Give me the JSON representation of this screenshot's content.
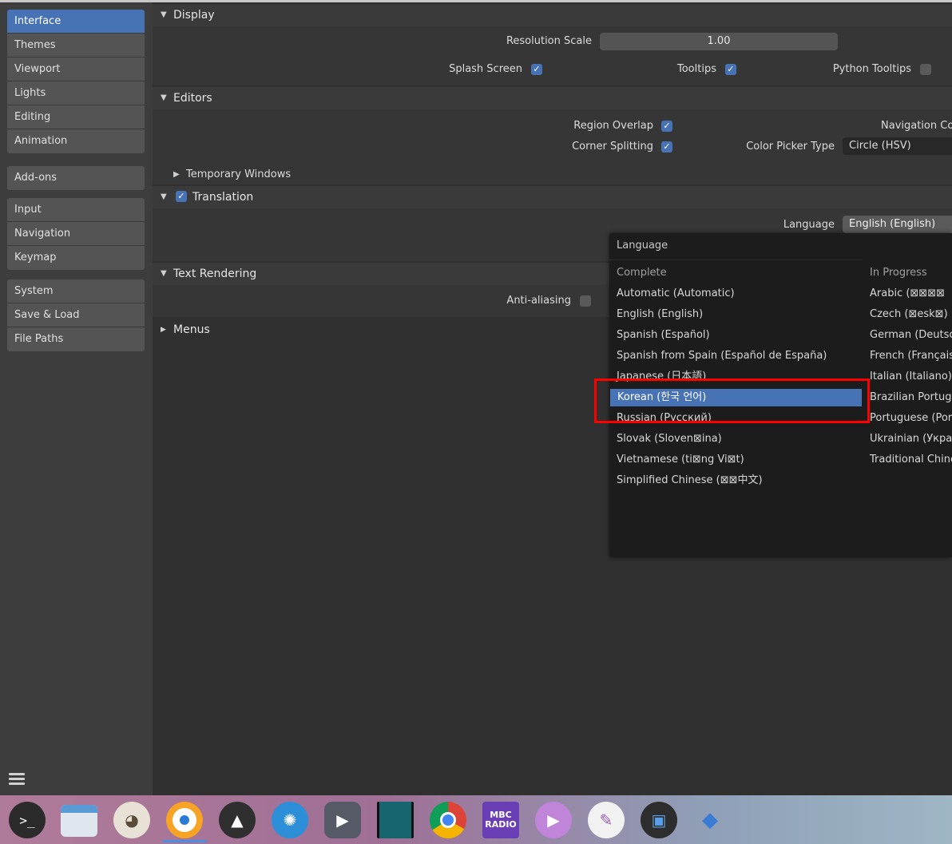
{
  "sidebar": {
    "groups": [
      [
        "Interface",
        "Themes",
        "Viewport",
        "Lights",
        "Editing",
        "Animation"
      ],
      [
        "Add-ons"
      ],
      [
        "Input",
        "Navigation",
        "Keymap"
      ],
      [
        "System",
        "Save & Load",
        "File Paths"
      ]
    ],
    "active": "Interface"
  },
  "display": {
    "header": "Display",
    "resolution_label": "Resolution Scale",
    "resolution_value": "1.00",
    "splash_label": "Splash Screen",
    "tooltips_label": "Tooltips",
    "python_tooltips_label": "Python Tooltips"
  },
  "editors": {
    "header": "Editors",
    "region_overlap_label": "Region Overlap",
    "navigation_controls_label": "Navigation Cor",
    "corner_splitting_label": "Corner Splitting",
    "color_picker_label": "Color Picker Type",
    "color_picker_value": "Circle (HSV)",
    "temp_windows_label": "Temporary Windows"
  },
  "translation": {
    "header": "Translation",
    "language_label": "Language",
    "language_value": "English (English)"
  },
  "text_rendering": {
    "header": "Text Rendering",
    "antialiasing_label": "Anti-aliasing"
  },
  "menus": {
    "header": "Menus"
  },
  "popup": {
    "title": "Language",
    "complete_header": "Complete",
    "in_progress_header": "In Progress",
    "complete": [
      "Automatic (Automatic)",
      "English (English)",
      "Spanish (Español)",
      "Spanish from Spain (Español de España)",
      "Japanese (日本語)",
      "Korean (한국 언어)",
      "Russian (Русский)",
      "Slovak (Sloven⊠ina)",
      "Vietnamese (ti⊠ng Vi⊠t)",
      "Simplified Chinese (⊠⊠中文)"
    ],
    "in_progress": [
      "Arabic (⊠⊠⊠⊠",
      "Czech (⊠esk⊠)",
      "German (Deutsch",
      "French (Français)",
      "Italian (Italiano)",
      "Brazilian Portugu",
      "Portuguese (Port",
      "Ukrainian (Украï",
      "Traditional Chine"
    ],
    "highlighted": "Korean (한국 언어)"
  },
  "taskbar": {
    "icons": [
      "terminal-icon",
      "files-icon",
      "gimp-icon",
      "orange-app-icon",
      "inkscape-icon",
      "shotwell-icon",
      "video-player-icon",
      "panel-app-icon",
      "chrome-icon",
      "mbc-radio-icon",
      "media-play-icon",
      "text-editor-icon",
      "wallet-icon",
      "tools-icon"
    ],
    "mbc_line1": "MBC",
    "mbc_line2": "RADIO"
  },
  "colors": {
    "accent": "#4772b3",
    "highlight_box": "#ff0000"
  }
}
